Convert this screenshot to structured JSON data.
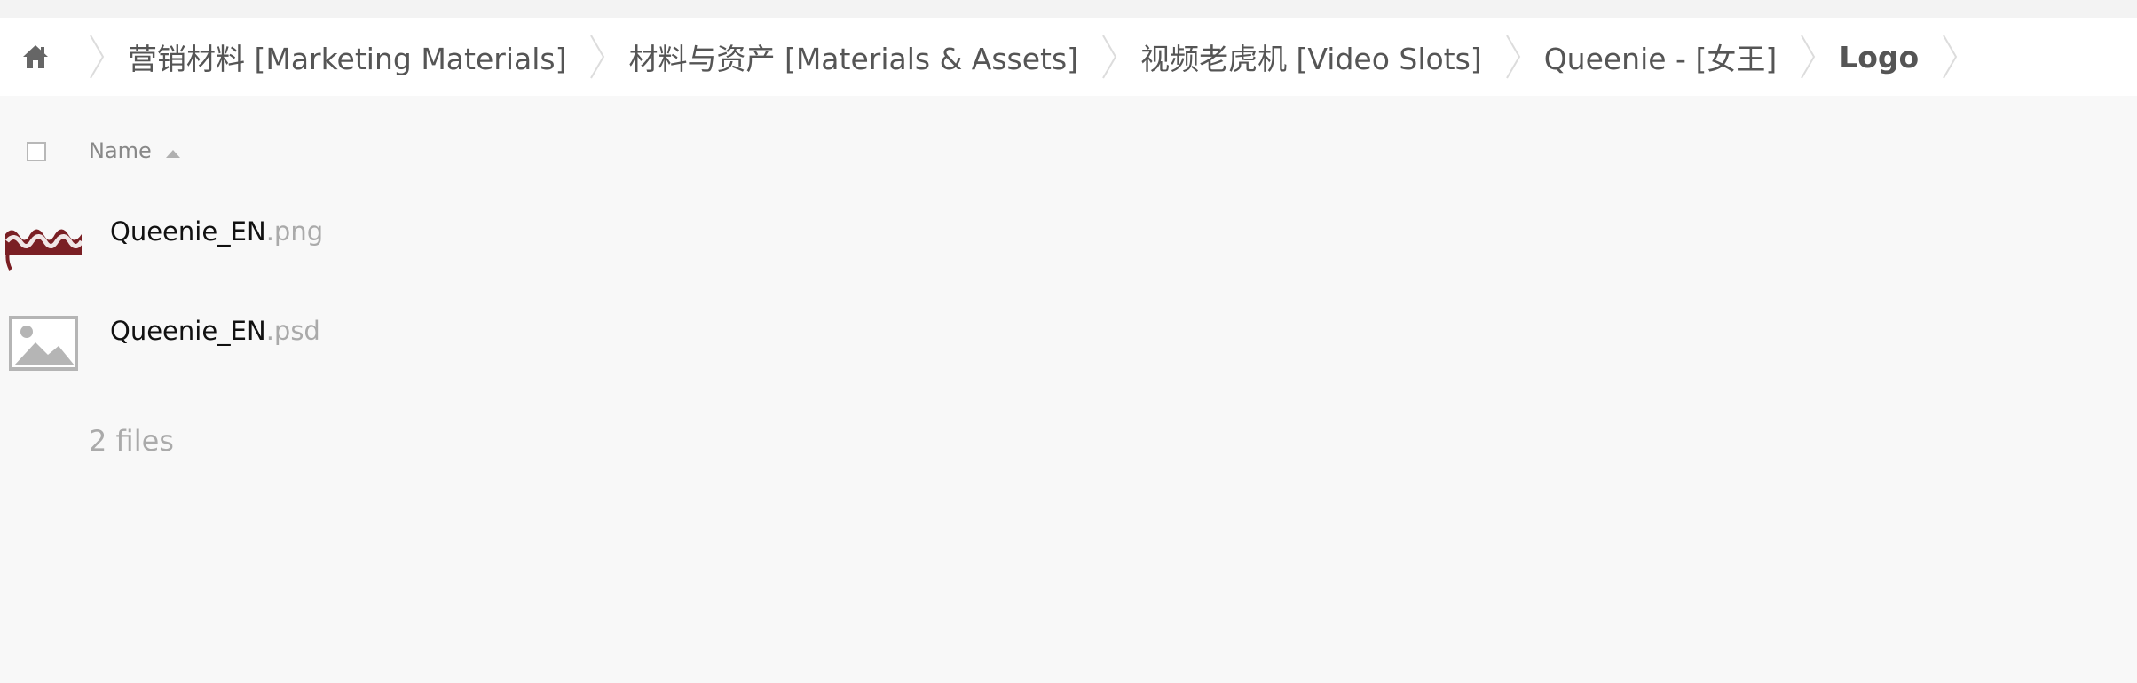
{
  "breadcrumb": {
    "home_icon": "home-icon",
    "items": [
      {
        "label": "营销材料 [Marketing Materials]"
      },
      {
        "label": "材料与资产 [Materials & Assets]"
      },
      {
        "label": "视频老虎机 [Video Slots]"
      },
      {
        "label": "Queenie - [女王]"
      },
      {
        "label": "Logo"
      }
    ]
  },
  "list": {
    "header": {
      "name_label": "Name",
      "sort": "ascending"
    },
    "files": [
      {
        "base": "Queenie_EN",
        "ext": ".png",
        "thumb": "logo-thumbnail"
      },
      {
        "base": "Queenie_EN",
        "ext": ".psd",
        "thumb": "image-placeholder-icon"
      }
    ],
    "count_label": "2 files"
  },
  "colors": {
    "background": "#f8f8f8",
    "bar": "#ffffff",
    "text": "#555555",
    "muted": "#aaaaaa"
  }
}
